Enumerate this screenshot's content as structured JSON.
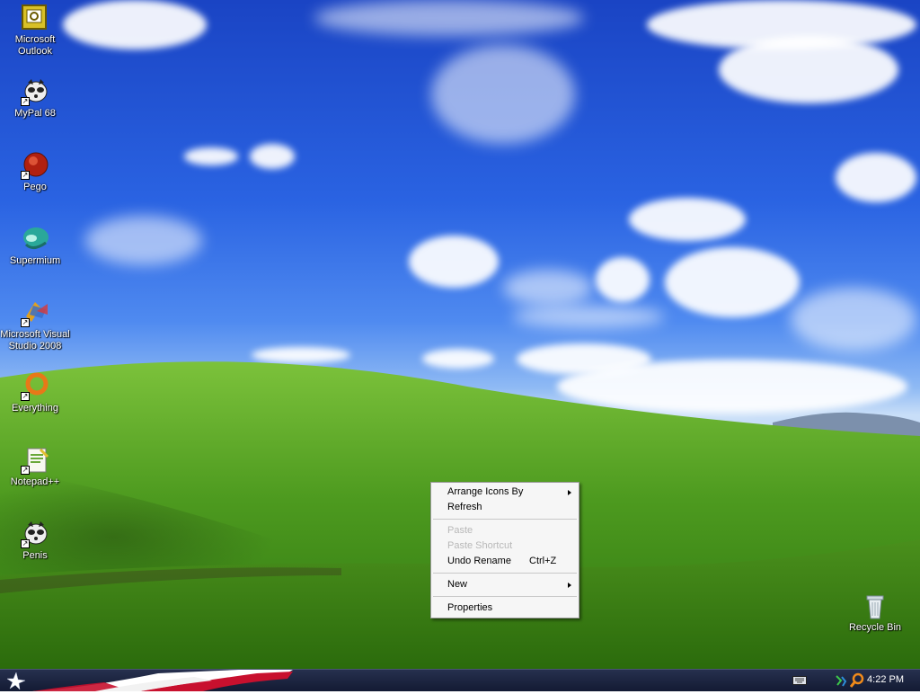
{
  "desktop": {
    "icons": [
      {
        "label": "Microsoft Outlook",
        "icon": "outlook-icon"
      },
      {
        "label": "MyPal 68",
        "icon": "mypal-icon"
      },
      {
        "label": "Pego",
        "icon": "pego-icon"
      },
      {
        "label": "Supermium",
        "icon": "supermium-icon"
      },
      {
        "label": "Microsoft Visual Studio 2008",
        "icon": "visual-studio-icon"
      },
      {
        "label": "Everything",
        "icon": "everything-icon"
      },
      {
        "label": "Notepad++",
        "icon": "notepadpp-icon"
      },
      {
        "label": "Penis",
        "icon": "mypal-icon"
      }
    ],
    "recycle_bin": {
      "label": "Recycle Bin",
      "icon": "recycle-bin-icon"
    }
  },
  "context_menu": {
    "items": [
      {
        "label": "Arrange Icons By",
        "submenu": true
      },
      {
        "label": "Refresh"
      },
      {
        "separator": true
      },
      {
        "label": "Paste",
        "disabled": true
      },
      {
        "label": "Paste Shortcut",
        "disabled": true
      },
      {
        "label": "Undo Rename",
        "shortcut": "Ctrl+Z"
      },
      {
        "separator": true
      },
      {
        "label": "New",
        "submenu": true
      },
      {
        "separator": true
      },
      {
        "label": "Properties"
      }
    ]
  },
  "taskbar": {
    "start_icon": "start-star-icon",
    "tray_icons": [
      "keyboard-icon",
      "network-icon",
      "search-icon"
    ],
    "clock": "4:22 PM"
  }
}
